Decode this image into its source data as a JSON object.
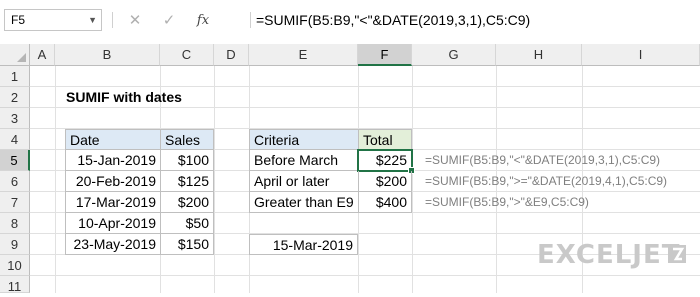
{
  "formula_bar": {
    "name_box": "F5",
    "cancel_icon": "✕",
    "enter_icon": "✓",
    "fx_label": "fx",
    "formula": "=SUMIF(B5:B9,\"<\"&DATE(2019,3,1),C5:C9)"
  },
  "sheet": {
    "columns": [
      "A",
      "B",
      "C",
      "D",
      "E",
      "F",
      "G",
      "H",
      "I"
    ],
    "rows": [
      "1",
      "2",
      "3",
      "4",
      "5",
      "6",
      "7",
      "8",
      "9",
      "10",
      "11"
    ],
    "active_cell": "F5",
    "title": "SUMIF with dates",
    "data_table": {
      "headers": {
        "date": "Date",
        "sales": "Sales"
      },
      "rows": [
        {
          "date": "15-Jan-2019",
          "sales": "$100"
        },
        {
          "date": "20-Feb-2019",
          "sales": "$125"
        },
        {
          "date": "17-Mar-2019",
          "sales": "$200"
        },
        {
          "date": "10-Apr-2019",
          "sales": "$50"
        },
        {
          "date": "23-May-2019",
          "sales": "$150"
        }
      ]
    },
    "criteria_table": {
      "headers": {
        "criteria": "Criteria",
        "total": "Total"
      },
      "rows": [
        {
          "criteria": "Before March",
          "total": "$225",
          "formula": "=SUMIF(B5:B9,\"<\"&DATE(2019,3,1),C5:C9)"
        },
        {
          "criteria": "April or later",
          "total": "$200",
          "formula": "=SUMIF(B5:B9,\">=\"&DATE(2019,4,1),C5:C9)"
        },
        {
          "criteria": "Greater than E9",
          "total": "$400",
          "formula": "=SUMIF(B5:B9,\">\"&E9,C5:C9)"
        }
      ]
    },
    "e9_value": "15-Mar-2019"
  },
  "logo": {
    "text": "EXCELJET",
    "icon": "exceljet-logo-icon"
  },
  "colors": {
    "accent": "#217346",
    "header_fill": "#dde9f5",
    "total_fill": "#e3efd9"
  }
}
